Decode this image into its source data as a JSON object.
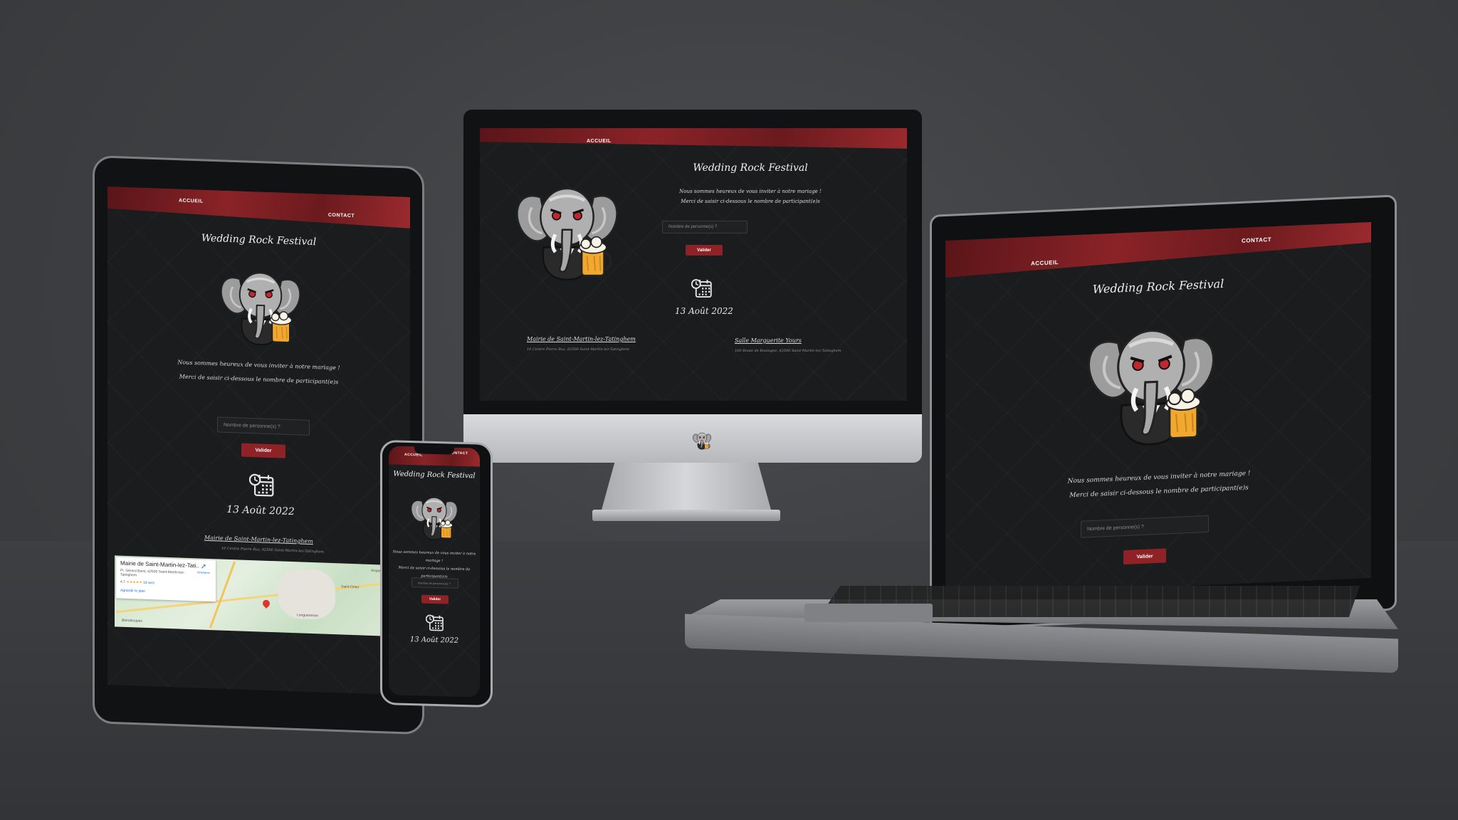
{
  "site": {
    "nav": {
      "home": "ACCUEIL",
      "contact": "CONTACT"
    },
    "title": "Wedding Rock Festival",
    "message_line1": "Nous sommes heureux de vous inviter à notre mariage !",
    "message_line2": "Merci de saisir ci-dessous le nombre de participant(e)s",
    "input_placeholder": "Nombre de personne(s) ?",
    "submit_label": "Valider",
    "date": "13 Août 2022",
    "venue1_name": "Mairie de Saint-Martin-lez-Tatinghem",
    "venue1_address": "10 Centre Pierre Ruz, 62500 Saint-Martin-lez-Tatinghem",
    "venue2_name": "Salle Marguerite Yours",
    "venue2_address": "160 Route de Boulogne, 62500 Saint-Martin-lez-Tatinghem"
  },
  "map": {
    "place_name": "Mairie de Saint-Martin-lez-Tati...",
    "place_address": "Pl. Gérard Bavo, 62500 Saint-Martin-lez-Tatinghem",
    "rating": "4,7",
    "stars": "★★★★★",
    "reviews": "18 avis",
    "enlarge": "Agrandir le plan",
    "directions": "Itinéraires",
    "labels": [
      "Longuenesse",
      "Saint-Omer",
      "Arques",
      "Blendecques"
    ]
  },
  "colors": {
    "accent": "#8e2226",
    "nav_dark": "#5a1518",
    "page_bg": "#1b1c1e",
    "backdrop": "#3e4043"
  },
  "icons": [
    "calendar-clock-icon",
    "elephant-beer-mascot",
    "map-pin-icon",
    "apple-style-logo-icon"
  ]
}
